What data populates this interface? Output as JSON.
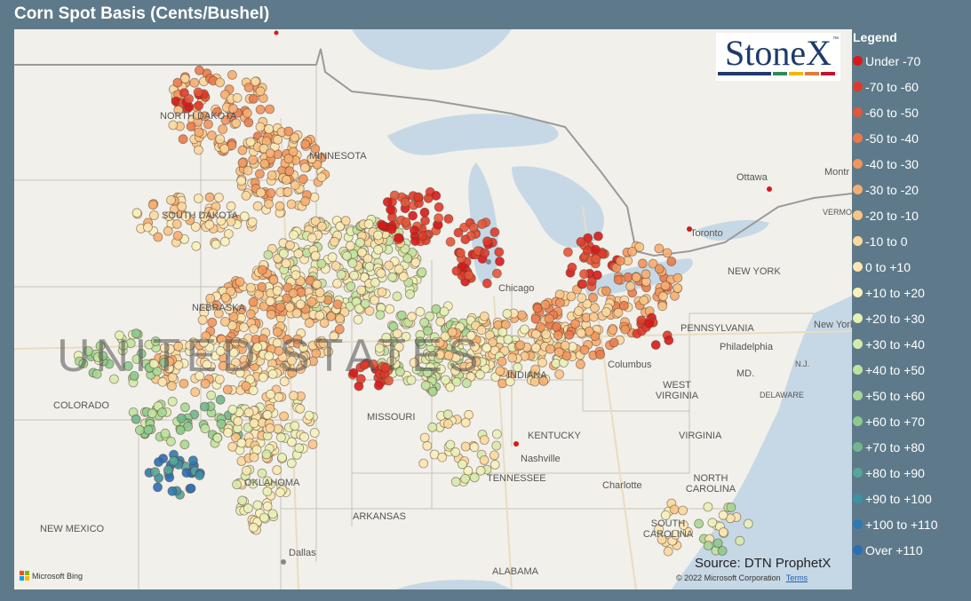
{
  "title": "Corn Spot Basis (Cents/Bushel)",
  "logo": {
    "text": "StoneX",
    "tm": "™",
    "bar_colors": [
      "#1d3a6b",
      "#2e8b57",
      "#f2b705",
      "#e07b39",
      "#c8102e"
    ]
  },
  "legend": {
    "title": "Legend",
    "items": [
      {
        "label": "Under -70",
        "color": "#d7191c"
      },
      {
        "label": "-70 to -60",
        "color": "#de3a2a"
      },
      {
        "label": "-60 to -50",
        "color": "#e4563a"
      },
      {
        "label": "-50 to -40",
        "color": "#ea7a4c"
      },
      {
        "label": "-40 to -30",
        "color": "#f0955c"
      },
      {
        "label": "-30 to -20",
        "color": "#f6ad70"
      },
      {
        "label": "-20 to -10",
        "color": "#f9c587"
      },
      {
        "label": "-10 to 0",
        "color": "#fbd89e"
      },
      {
        "label": "0 to +10",
        "color": "#fce6b1"
      },
      {
        "label": "+10 to +20",
        "color": "#f6f1bd"
      },
      {
        "label": "+20 to +30",
        "color": "#e8f1b8"
      },
      {
        "label": "+30 to +40",
        "color": "#d5ebac"
      },
      {
        "label": "+40 to +50",
        "color": "#c0e2a0"
      },
      {
        "label": "+50 to +60",
        "color": "#a6d795"
      },
      {
        "label": "+60 to +70",
        "color": "#8cca8e"
      },
      {
        "label": "+70 to +80",
        "color": "#6fb68c"
      },
      {
        "label": "+80 to +90",
        "color": "#56a59a"
      },
      {
        "label": "+90 to +100",
        "color": "#3e91a3"
      },
      {
        "label": "+100 to +110",
        "color": "#2b7bb0"
      },
      {
        "label": "Over +110",
        "color": "#2a6db8"
      }
    ]
  },
  "map_labels": {
    "north_dakota": "NORTH DAKOTA",
    "minnesota": "MINNESOTA",
    "south_dakota": "SOUTH DAKOTA",
    "nebraska": "NEBRASKA",
    "colorado": "COLORADO",
    "missouri": "MISSOURI",
    "oklahoma": "OKLAHOMA",
    "arkansas": "ARKANSAS",
    "new_mexico": "NEW MEXICO",
    "dallas": "Dallas",
    "alabama": "ALABAMA",
    "tennessee": "TENNESSEE",
    "nashville": "Nashville",
    "kentucky": "KENTUCKY",
    "indiana": "INDIANA",
    "chicago": "Chicago",
    "columbus": "Columbus",
    "west_virginia": "WEST VIRGINIA",
    "virginia": "VIRGINIA",
    "north_carolina": "NORTH CAROLINA",
    "charlotte": "Charlotte",
    "south_carolina": "SOUTH CAROLINA",
    "pennsylvania": "PENNSYLVANIA",
    "philadelphia": "Philadelphia",
    "new_york_state": "NEW YORK",
    "new_york_city": "New York",
    "ottawa": "Ottawa",
    "toronto": "Toronto",
    "montreal": "Montr",
    "vermont": "VERMO",
    "md": "MD.",
    "nj": "N.J.",
    "delaware": "DELAWARE",
    "united_states": "UNITED STATES"
  },
  "source": "Source: DTN ProphetX",
  "copyright": "© 2022 Microsoft Corporation",
  "terms": "Terms",
  "bing": "Microsoft Bing"
}
